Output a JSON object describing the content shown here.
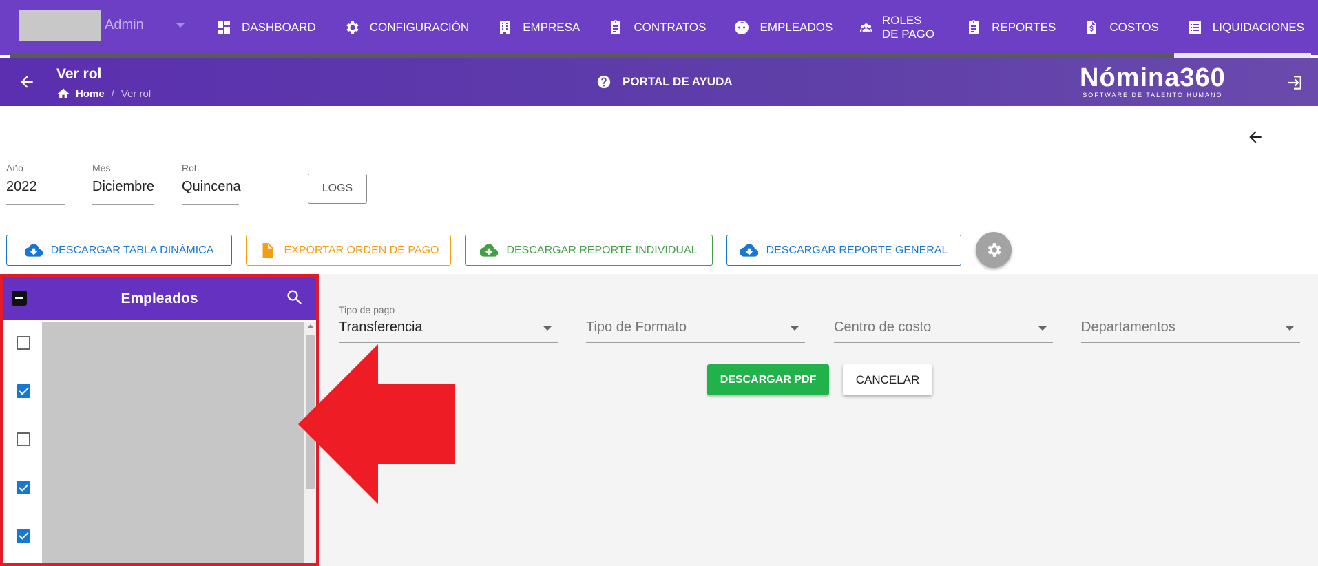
{
  "topnav": {
    "company_selector": {
      "value": "Admin"
    },
    "items": [
      {
        "label": "DASHBOARD",
        "icon": "dashboard-icon"
      },
      {
        "label": "CONFIGURACIÓN",
        "icon": "gear-icon"
      },
      {
        "label": "EMPRESA",
        "icon": "building-icon"
      },
      {
        "label": "CONTRATOS",
        "icon": "clipboard-icon"
      },
      {
        "label": "EMPLEADOS",
        "icon": "face-icon"
      },
      {
        "label": "ROLES DE PAGO",
        "icon": "users-icon"
      },
      {
        "label": "REPORTES",
        "icon": "clipboard-icon"
      },
      {
        "label": "COSTOS",
        "icon": "invoice-icon"
      },
      {
        "label": "LIQUIDACIONES",
        "icon": "list-icon"
      }
    ],
    "progress": 0.9
  },
  "subheader": {
    "title": "Ver rol",
    "breadcrumb": {
      "home": "Home",
      "separator": "/",
      "current": "Ver rol"
    },
    "help_label": "PORTAL DE AYUDA",
    "brand_name": "Nómina360",
    "brand_tagline": "SOFTWARE DE TALENTO HUMANO"
  },
  "filters": {
    "anio": {
      "label": "Año",
      "value": "2022"
    },
    "mes": {
      "label": "Mes",
      "value": "Diciembre"
    },
    "rol": {
      "label": "Rol",
      "value": "Quincena"
    },
    "logs_label": "LOGS"
  },
  "actions": {
    "tabla_dinamica": "DESCARGAR TABLA DINÁMICA",
    "orden_pago": "EXPORTAR ORDEN DE PAGO",
    "reporte_individual": "DESCARGAR REPORTE INDIVIDUAL",
    "reporte_general": "DESCARGAR REPORTE GENERAL"
  },
  "empleados": {
    "title": "Empleados",
    "checked": [
      false,
      true,
      false,
      true,
      true
    ]
  },
  "form": {
    "tipo_pago": {
      "label": "Tipo de pago",
      "value": "Transferencia"
    },
    "tipo_formato": {
      "placeholder": "Tipo de Formato"
    },
    "centro_costo": {
      "placeholder": "Centro de costo"
    },
    "departamentos": {
      "placeholder": "Departamentos"
    },
    "descargar_pdf": "DESCARGAR PDF",
    "cancelar": "CANCELAR"
  },
  "colors": {
    "primary": "#6c3fc4",
    "blue": "#1877d2",
    "orange": "#f59d12",
    "green": "#43a047",
    "highlight": "#e21b2b"
  }
}
